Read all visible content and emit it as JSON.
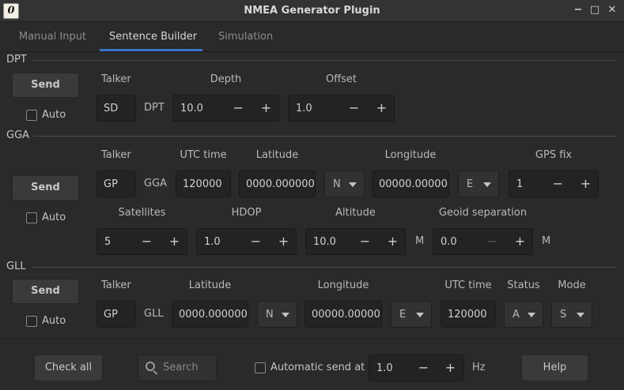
{
  "window": {
    "title": "NMEA Generator Plugin",
    "icon_glyph": "0",
    "minimize": "−",
    "maximize": "□",
    "close": "✕"
  },
  "tabs": [
    {
      "label": "Manual Input",
      "active": false
    },
    {
      "label": "Sentence Builder",
      "active": true
    },
    {
      "label": "Simulation",
      "active": false
    }
  ],
  "dpt": {
    "title": "DPT",
    "send_label": "Send",
    "auto_label": "Auto",
    "talker_label": "Talker",
    "talker_value": "SD",
    "sentence": "DPT",
    "depth_label": "Depth",
    "depth_value": "10.0",
    "offset_label": "Offset",
    "offset_value": "1.0"
  },
  "gga": {
    "title": "GGA",
    "send_label": "Send",
    "auto_label": "Auto",
    "talker_label": "Talker",
    "talker_value": "GP",
    "sentence": "GGA",
    "utc_label": "UTC time",
    "utc_value": "120000",
    "lat_label": "Latitude",
    "lat_value": "0000.000000",
    "lat_dir": "N",
    "lon_label": "Longitude",
    "lon_value": "00000.000000",
    "lon_dir": "E",
    "fix_label": "GPS fix",
    "fix_value": "1",
    "sat_label": "Satellites",
    "sat_value": "5",
    "hdop_label": "HDOP",
    "hdop_value": "1.0",
    "alt_label": "Altitude",
    "alt_value": "10.0",
    "alt_unit": "M",
    "geoid_label": "Geoid separation",
    "geoid_value": "0.0",
    "geoid_unit": "M"
  },
  "gll": {
    "title": "GLL",
    "send_label": "Send",
    "auto_label": "Auto",
    "talker_label": "Talker",
    "talker_value": "GP",
    "sentence": "GLL",
    "lat_label": "Latitude",
    "lat_value": "0000.000000",
    "lat_dir": "N",
    "lon_label": "Longitude",
    "lon_value": "00000.000000",
    "lon_dir": "E",
    "utc_label": "UTC time",
    "utc_value": "120000",
    "status_label": "Status",
    "status_value": "A",
    "mode_label": "Mode",
    "mode_value": "S"
  },
  "footer": {
    "check_all": "Check all",
    "search_placeholder": "Search",
    "auto_send_label": "Automatic send at",
    "rate_value": "1.0",
    "rate_unit": "Hz",
    "help": "Help"
  },
  "spin_minus": "−",
  "spin_plus": "+"
}
